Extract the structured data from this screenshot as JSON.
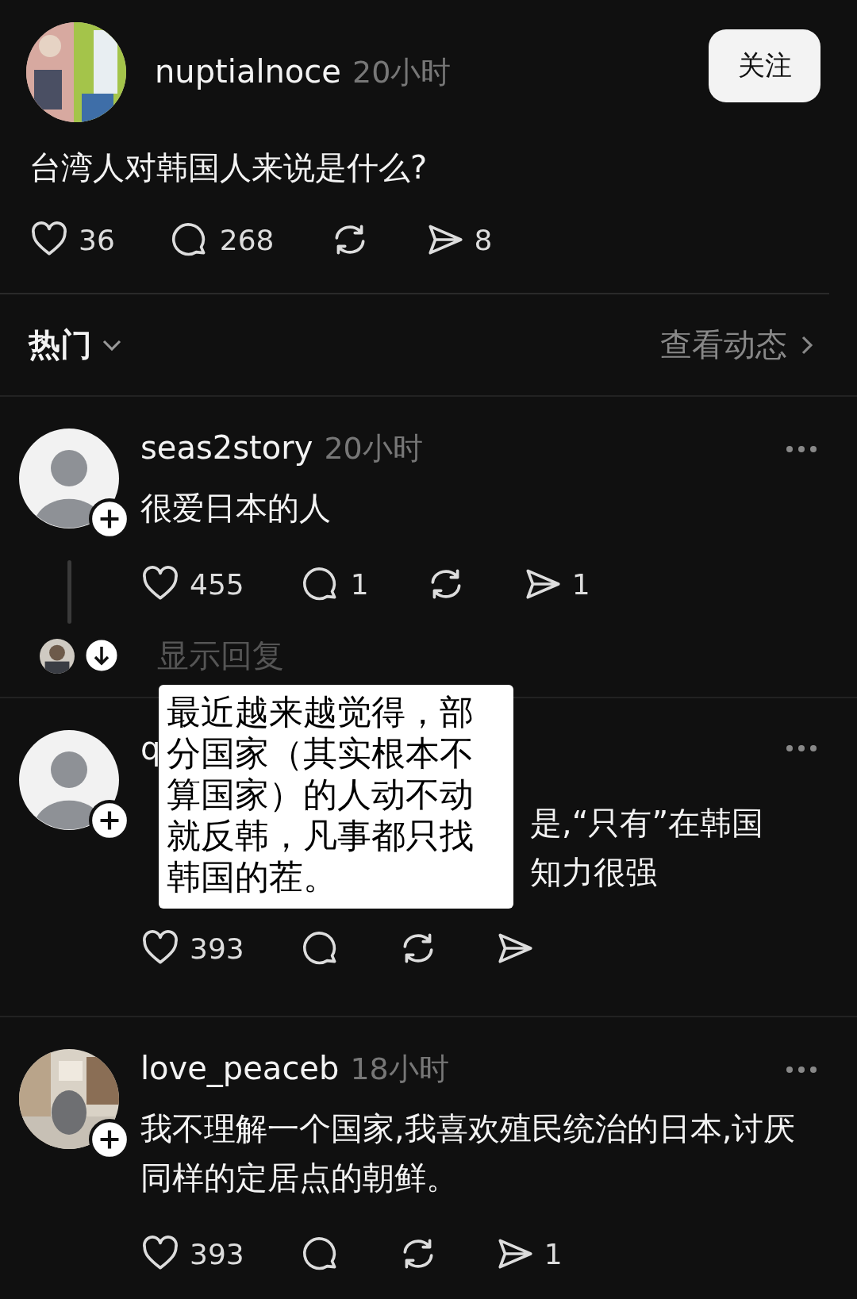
{
  "post": {
    "author": "nuptialnoce",
    "time": "20小时",
    "follow_button": "关注",
    "text": "台湾人对韩国人来说是什么?",
    "actions": [
      {
        "kind": "like",
        "count": "36"
      },
      {
        "kind": "comment",
        "count": "268"
      },
      {
        "kind": "repost"
      },
      {
        "kind": "share",
        "count": "8"
      }
    ]
  },
  "sort": {
    "label": "热门",
    "link": "查看动态"
  },
  "comments": [
    {
      "avatar": {
        "kind": "default"
      },
      "author": "seas2story",
      "time": "20小时",
      "lines": [
        [
          "很爱日本的人"
        ]
      ],
      "actions": [
        {
          "kind": "like",
          "count": "455"
        },
        {
          "kind": "comment",
          "count": "1"
        },
        {
          "kind": "repost"
        },
        {
          "kind": "share",
          "count": "1"
        }
      ],
      "show_replies": "显示回复"
    },
    {
      "avatar": {
        "kind": "default"
      },
      "author": "q",
      "lines": [
        [
          "是,“只有”在韩国"
        ],
        [
          "知力很强"
        ]
      ],
      "actions": [
        {
          "kind": "like",
          "count": "393"
        },
        {
          "kind": "comment"
        },
        {
          "kind": "repost"
        },
        {
          "kind": "share"
        }
      ]
    },
    {
      "avatar": {
        "kind": "picture"
      },
      "author": "love_peaceb",
      "time": "18小时",
      "lines": [
        [
          "我不理解一个国家,我喜欢殖民统治的日本,讨厌同样的定居点的朝鲜。"
        ]
      ],
      "actions": [
        {
          "kind": "like",
          "count": "393"
        },
        {
          "kind": "comment"
        },
        {
          "kind": "repost"
        },
        {
          "kind": "share",
          "count": "1"
        }
      ]
    }
  ],
  "overlay": {
    "text": "最近越来越觉得，部分国家（其实根本不算国家）的人动不动就反韩，凡事都只找韩国的茬。"
  }
}
